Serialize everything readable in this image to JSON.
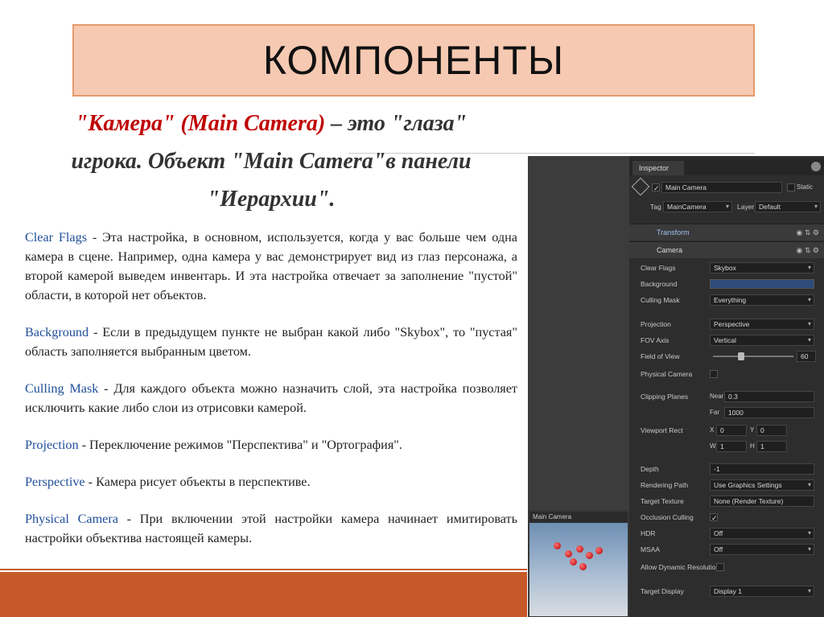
{
  "slide": {
    "title": "КОМПОНЕНТЫ",
    "heading": {
      "part1_red": "\"Камера\" (Main Camera)",
      "part1_rest": " – это \"глаза\"",
      "line2": "игрока. Объект \"Main Camera\"в панели",
      "line3": "\"Иерархии\"."
    },
    "paragraphs": [
      {
        "term": "Clear Flags",
        "text": " - Эта настройка, в основном, используется, когда у вас больше чем одна камера в сцене. Например, одна камера у вас демонстрирует вид из глаз персонажа, а второй камерой выведем инвентарь. И эта настройка отвечает за заполнение \"пустой\" области, в которой нет объектов."
      },
      {
        "term": "Background",
        "text": " - Если в предыдущем пункте не выбран какой либо \"Skybox\", то \"пустая\" область заполняется выбранным цветом."
      },
      {
        "term": "Culling Mask",
        "text": " - Для каждого объекта можно назначить слой, эта настройка позволяет исключить какие либо слои из отрисовки камерой."
      },
      {
        "term": "Projection",
        "text": " - Переключение режимов \"Перспектива\" и \"Ортография\"."
      },
      {
        "term": "Perspective",
        "text": " - Камера рисует объекты в перспективе."
      },
      {
        "term": "Physical Camera",
        "text": " - При включении этой настройки камера начинает имитировать настройки объектива настоящей камеры."
      }
    ]
  },
  "inspector": {
    "tab": "Inspector",
    "object_name": "Main Camera",
    "static_label": "Static",
    "tag_label": "Tag",
    "tag_value": "MainCamera",
    "layer_label": "Layer",
    "layer_value": "Default",
    "transform_label": "Transform",
    "camera_label": "Camera",
    "camera_view_title": "Main Camera",
    "fields": {
      "clear_flags": {
        "label": "Clear Flags",
        "value": "Skybox"
      },
      "background": {
        "label": "Background"
      },
      "culling_mask": {
        "label": "Culling Mask",
        "value": "Everything"
      },
      "projection": {
        "label": "Projection",
        "value": "Perspective"
      },
      "fov_axis": {
        "label": "FOV Axis",
        "value": "Vertical"
      },
      "field_of_view": {
        "label": "Field of View",
        "value": "60",
        "fraction": 0.35
      },
      "physical_camera": {
        "label": "Physical Camera"
      },
      "clipping_planes": {
        "label": "Clipping Planes",
        "near_label": "Near",
        "near": "0.3",
        "far_label": "Far",
        "far": "1000"
      },
      "viewport_rect": {
        "label": "Viewport Rect",
        "x_label": "X",
        "x": "0",
        "y_label": "Y",
        "y": "0",
        "w_label": "W",
        "w": "1",
        "h_label": "H",
        "h": "1"
      },
      "depth": {
        "label": "Depth",
        "value": "-1"
      },
      "rendering_path": {
        "label": "Rendering Path",
        "value": "Use Graphics Settings"
      },
      "target_texture": {
        "label": "Target Texture",
        "value": "None (Render Texture)"
      },
      "occlusion_culling": {
        "label": "Occlusion Culling"
      },
      "hdr": {
        "label": "HDR",
        "value": "Off"
      },
      "msaa": {
        "label": "MSAA",
        "value": "Off"
      },
      "allow_dynamic_resolution": {
        "label": "Allow Dynamic Resolution"
      },
      "target_display": {
        "label": "Target Display",
        "value": "Display 1"
      }
    }
  },
  "colors": {
    "title_bg": "#f6c9b2",
    "accent_orange": "#c55a28",
    "heading_red": "#c00000",
    "term_blue": "#1f4e99",
    "inspector_bg": "#2d2d2d"
  }
}
